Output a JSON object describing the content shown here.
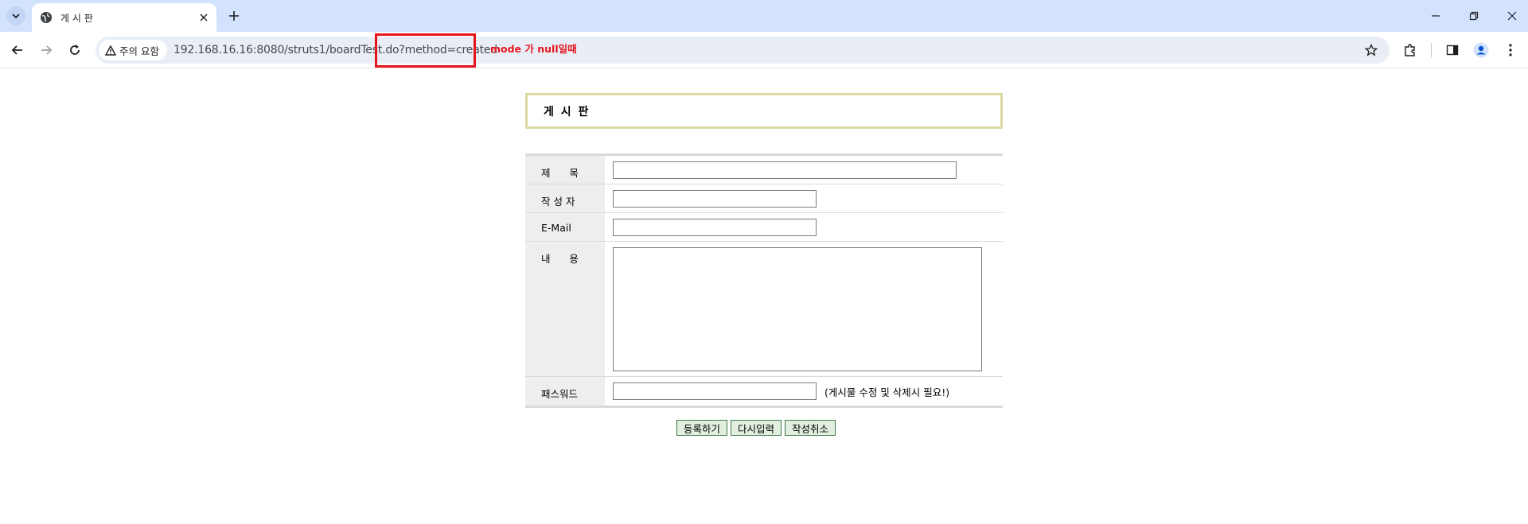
{
  "browser": {
    "tab_title": "게 시 판",
    "security_label": "주의 요함",
    "url": "192.168.16.16:8080/struts1/boardTest.do?method=created"
  },
  "annotation": {
    "note": "mode 가 null일때",
    "color": "#e8141c"
  },
  "board": {
    "title": "게 시 판",
    "fields": {
      "subject_label": "제      목",
      "author_label": "작 성 자",
      "email_label": "E-Mail",
      "content_label": "내      용",
      "password_label": "패스워드",
      "password_hint": "(게시물 수정 및 삭제시 필요!)",
      "subject_value": "",
      "author_value": "",
      "email_value": "",
      "content_value": "",
      "password_value": ""
    },
    "buttons": {
      "submit": "등록하기",
      "reset": "다시입력",
      "cancel": "작성취소"
    }
  },
  "colors": {
    "tabstrip": "#d3e3fd",
    "header_border": "#dad8a5",
    "label_bg": "#eeeeee",
    "button_bg": "#e2efe0",
    "button_border": "#3b7a45"
  }
}
